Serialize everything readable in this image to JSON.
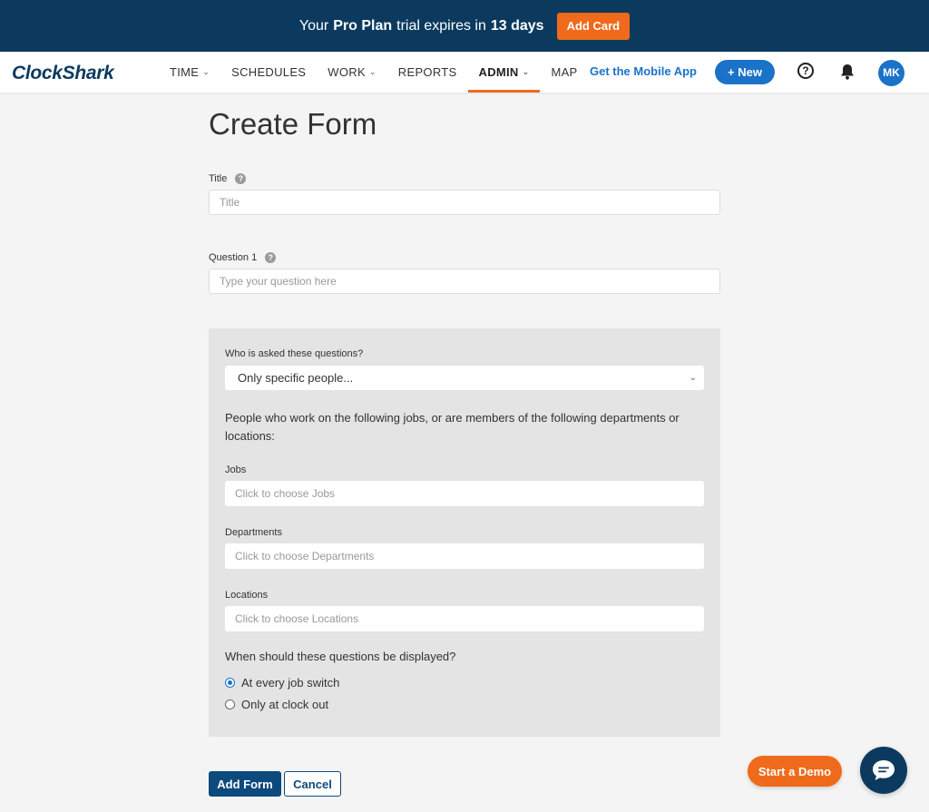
{
  "banner": {
    "prefix": "Your",
    "plan": "Pro Plan",
    "middle": "trial expires in",
    "days": "13 days",
    "button_label": "Add Card"
  },
  "nav": {
    "logo": "ClockShark",
    "items": [
      {
        "label": "TIME",
        "has_dropdown": true
      },
      {
        "label": "SCHEDULES",
        "has_dropdown": false
      },
      {
        "label": "WORK",
        "has_dropdown": true
      },
      {
        "label": "REPORTS",
        "has_dropdown": false
      },
      {
        "label": "ADMIN",
        "has_dropdown": true,
        "active": true
      },
      {
        "label": "MAP",
        "has_dropdown": false
      }
    ],
    "mobile_link": "Get the Mobile App",
    "new_button": "+ New",
    "help_icon": "help-circle-icon",
    "notification_icon": "bell-icon",
    "avatar_initials": "MK"
  },
  "page": {
    "title": "Create Form",
    "title_field": {
      "label": "Title",
      "placeholder": "Title"
    },
    "question_field": {
      "label": "Question 1",
      "placeholder": "Type your question here"
    },
    "audience": {
      "label": "Who is asked these questions?",
      "selected": "Only specific people...",
      "description": "People who work on the following jobs, or are members of the following departments or locations:",
      "jobs": {
        "label": "Jobs",
        "placeholder": "Click to choose Jobs"
      },
      "departments": {
        "label": "Departments",
        "placeholder": "Click to choose Departments"
      },
      "locations": {
        "label": "Locations",
        "placeholder": "Click to choose Locations"
      },
      "display_question": "When should these questions be displayed?",
      "options": [
        {
          "label": "At every job switch",
          "checked": true
        },
        {
          "label": "Only at clock out",
          "checked": false
        }
      ]
    },
    "add_button": "Add Form",
    "cancel_button": "Cancel"
  },
  "floating": {
    "demo_button": "Start a Demo",
    "chat_icon": "chat-bubble-icon"
  },
  "colors": {
    "banner_bg": "#0c3a5f",
    "accent_orange": "#ef6a1b",
    "primary_blue": "#1a73c8",
    "panel_bg": "#e4e4e4"
  }
}
